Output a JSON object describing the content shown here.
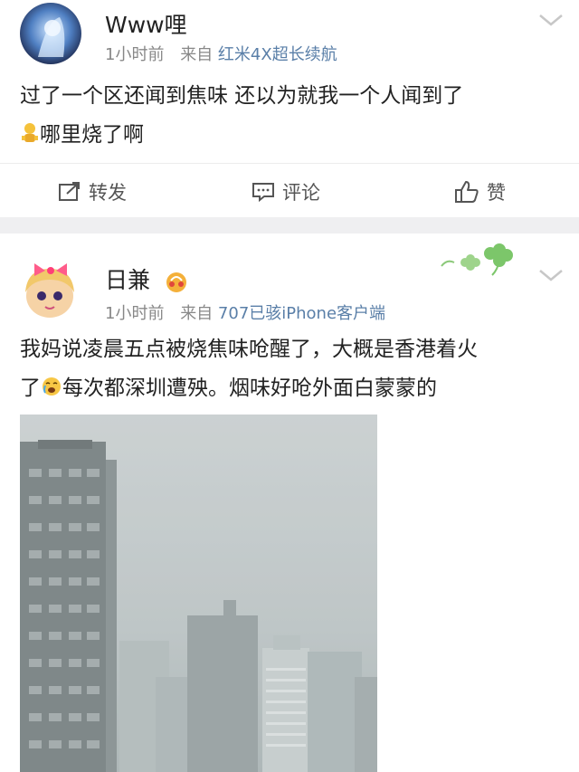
{
  "post1": {
    "username": "Www哩",
    "time": "1小时前",
    "source_prefix": "来自",
    "source": "红米4X超长续航",
    "text_line1": "过了一个区还闻到焦味 还以为就我一个人闻到了",
    "text_line2": "哪里烧了啊",
    "actions": {
      "repost": "转发",
      "comment": "评论",
      "like": "赞"
    }
  },
  "post2": {
    "username": "日兼",
    "time": "1小时前",
    "source_prefix": "来自",
    "source": "707已骇iPhone客户端",
    "text_line1": "我妈说凌晨五点被烧焦味呛醒了，大概是香港着火",
    "text_line2a": "了",
    "text_line2b": "每次都深圳遭殃。烟味好呛外面白蒙蒙的"
  },
  "colors": {
    "source_link": "#5a7fa8",
    "divider": "#efeff1"
  },
  "icons": [
    "chevron-down-icon",
    "repost-icon",
    "comment-icon",
    "like-icon",
    "clover-icon",
    "crying-emoji-icon",
    "shrug-emoji-icon",
    "vip-badge-icon"
  ]
}
